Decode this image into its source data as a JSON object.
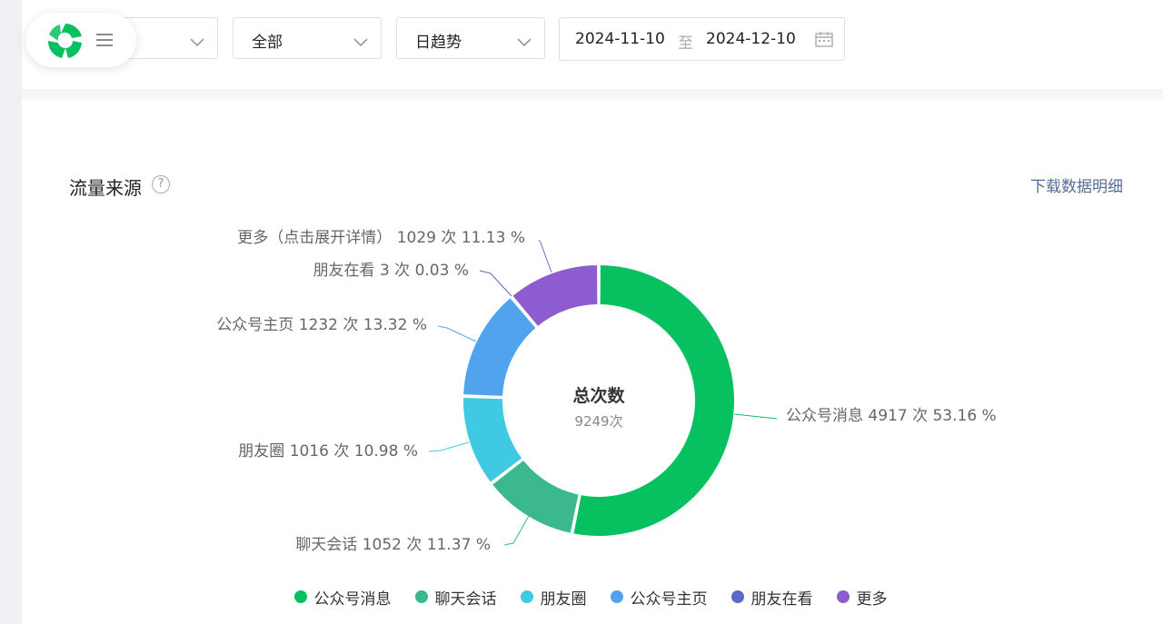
{
  "filters": {
    "select1": "",
    "select2": "全部",
    "select3": "日趋势",
    "date_start": "2024-11-10",
    "date_sep": "至",
    "date_end": "2024-12-10"
  },
  "section": {
    "title": "流量来源",
    "help": "?",
    "download": "下载数据明细"
  },
  "colors": {
    "green": "#07c160",
    "teal": "#3bb98d",
    "cyan": "#40c9e2",
    "blue": "#52a3ee",
    "indigo": "#5b6ac4",
    "purple": "#8e5cd1"
  },
  "chart_data": {
    "type": "pie",
    "center_title": "总次数",
    "center_value": "9249次",
    "total": 9249,
    "slices": [
      {
        "name": "公众号消息",
        "value": 4917,
        "percent": 53.16,
        "label": "公众号消息 4917 次 53.16 %",
        "color": "#07c160"
      },
      {
        "name": "聊天会话",
        "value": 1052,
        "percent": 11.37,
        "label": "聊天会话 1052 次 11.37 %",
        "color": "#3bb98d"
      },
      {
        "name": "朋友圈",
        "value": 1016,
        "percent": 10.98,
        "label": "朋友圈 1016 次 10.98 %",
        "color": "#40c9e2"
      },
      {
        "name": "公众号主页",
        "value": 1232,
        "percent": 13.32,
        "label": "公众号主页 1232 次 13.32 %",
        "color": "#52a3ee"
      },
      {
        "name": "朋友在看",
        "value": 3,
        "percent": 0.03,
        "label": "朋友在看 3 次 0.03 %",
        "color": "#5b6ac4"
      },
      {
        "name": "更多",
        "value": 1029,
        "percent": 11.13,
        "label": "更多（点击展开详情） 1029 次 11.13 %",
        "color": "#8e5cd1"
      }
    ],
    "legend": [
      "公众号消息",
      "聊天会话",
      "朋友圈",
      "公众号主页",
      "朋友在看",
      "更多"
    ]
  }
}
